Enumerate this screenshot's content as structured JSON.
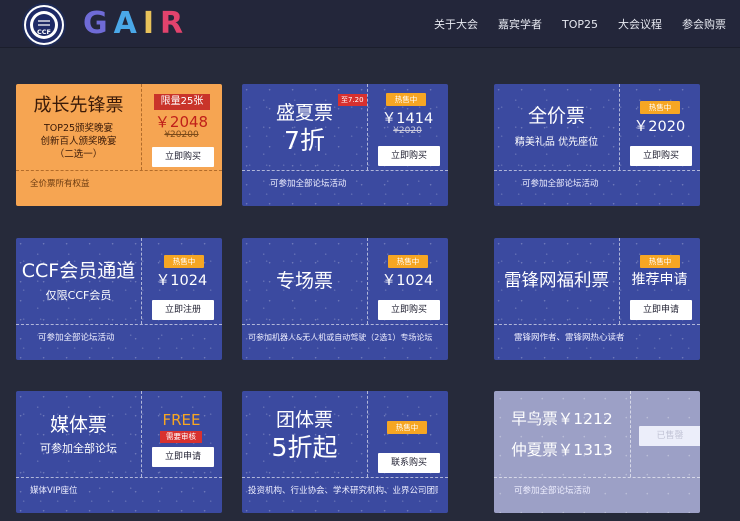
{
  "header": {
    "logo_text": "GAIR",
    "seal_text": "CCF",
    "nav": [
      "关于大会",
      "嘉宾学者",
      "TOP25",
      "大会议程",
      "参会购票"
    ]
  },
  "colors": {
    "orange_card": "#f6a552",
    "blue_card": "#3b4aa0",
    "badge": "#f6a623",
    "red": "#d8312f"
  },
  "cards": [
    {
      "title": "成长先锋票",
      "sub": [
        "TOP25颁奖晚宴",
        "创新百人颁奖晚宴",
        "（二选一）"
      ],
      "limit": "限量25张",
      "price": "￥2048",
      "original": "¥20200",
      "button": "立即购买",
      "footer": "全价票所有权益"
    },
    {
      "title": "盛夏票",
      "title2": "7折",
      "tag": "至7.20",
      "badge": "热售中",
      "price": "￥1414",
      "original": "¥2020",
      "button": "立即购买",
      "footer": "可参加全部论坛活动"
    },
    {
      "title": "全价票",
      "sub": "精美礼品  优先座位",
      "badge": "热售中",
      "price": "￥2020",
      "button": "立即购买",
      "footer": "可参加全部论坛活动"
    },
    {
      "title": "CCF会员通道",
      "sub": "仅限CCF会员",
      "badge": "热售中",
      "price": "￥1024",
      "button": "立即注册",
      "footer": "可参加全部论坛活动"
    },
    {
      "title": "专场票",
      "badge": "热售中",
      "price": "￥1024",
      "button": "立即购买",
      "footer": "可参加机器人&无人机或自动驾驶（2选1）专场论坛"
    },
    {
      "title": "雷锋网福利票",
      "badge": "热售中",
      "price_text": "推荐申请",
      "button": "立即申请",
      "footer": "雷锋网作者、雷锋网热心读者"
    },
    {
      "title": "媒体票",
      "sub": "可参加全部论坛",
      "free": "FREE",
      "review": "需要审核",
      "button": "立即申请",
      "footer": "媒体VIP座位"
    },
    {
      "title": "团体票",
      "title2": "5折起",
      "badge": "热售中",
      "button": "联系购买",
      "footer": "投资机构、行业协会、学术研究机构、业界公司团购"
    },
    {
      "line1": "早鸟票￥1212",
      "line2": "仲夏票￥1313",
      "button": "已售罄",
      "footer": "可参加全部论坛活动"
    }
  ]
}
